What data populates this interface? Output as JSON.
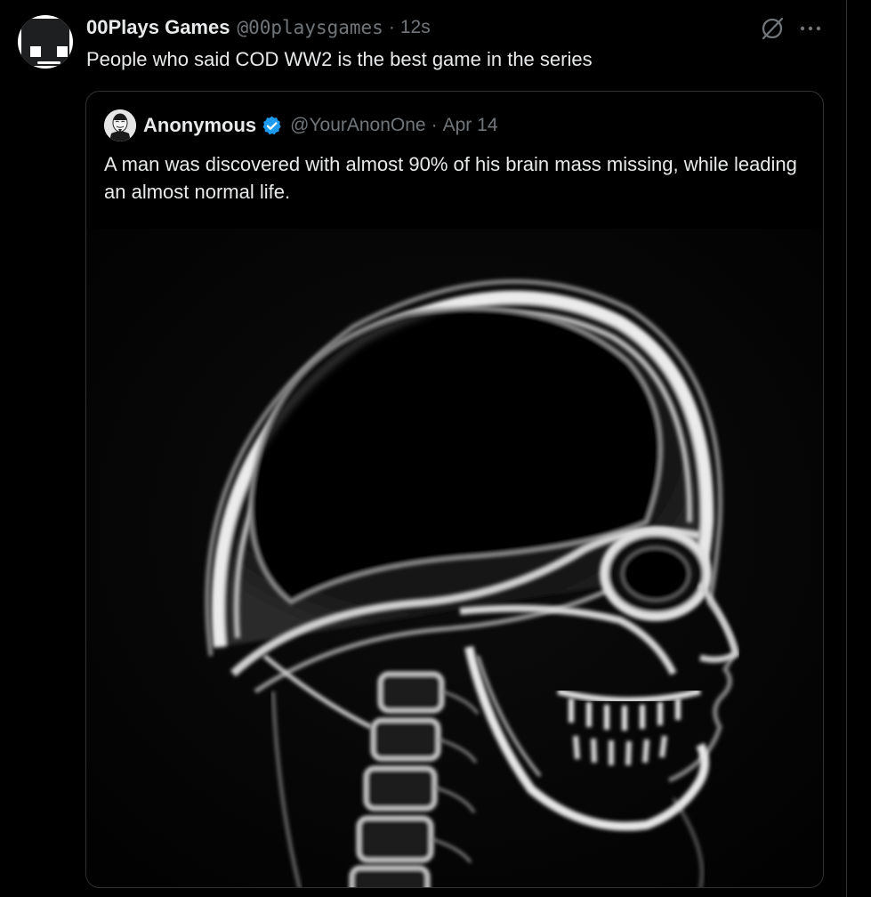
{
  "tweet": {
    "author": {
      "display_name": "00Plays Games",
      "handle": "@00playsgames",
      "avatar_icon": "robot-face-avatar"
    },
    "separator": "·",
    "timestamp": "12s",
    "text": "People who said COD WW2 is the best game in the series",
    "actions": {
      "grok_icon": "grok-icon",
      "more_icon": "more-horizontal-icon"
    }
  },
  "quoted_tweet": {
    "author": {
      "display_name": "Anonymous",
      "handle": "@YourAnonOne",
      "verified": true,
      "verified_color": "#1d9bf0",
      "avatar_icon": "anonymous-mask-avatar"
    },
    "separator": "·",
    "date": "Apr 14",
    "text": "A man was discovered with almost 90% of his brain mass missing, while leading an almost normal life.",
    "media": {
      "type": "image",
      "subject": "x-ray-skull-side-profile"
    }
  },
  "colors": {
    "background": "#000000",
    "text_primary": "#e7e9ea",
    "text_secondary": "#71767b",
    "border": "#2f3336",
    "accent": "#1d9bf0"
  }
}
